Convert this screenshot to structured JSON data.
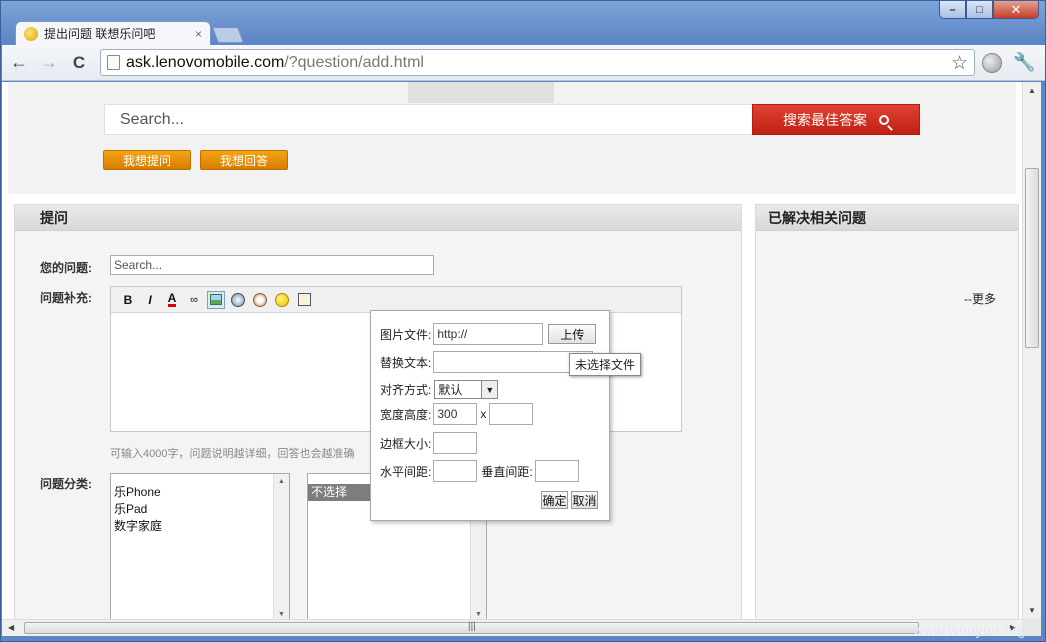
{
  "window": {
    "minimize_icon": "minimize-icon",
    "maximize_icon": "maximize-icon",
    "close_icon": "close-icon"
  },
  "tab": {
    "title": "提出问题 联想乐问吧",
    "close": "×"
  },
  "toolbar": {
    "back": "←",
    "forward": "→",
    "reload": "C",
    "url_host": "ask.lenovomobile.com",
    "url_path": "/?question/add.html",
    "star": "☆",
    "wrench": "🔧"
  },
  "header": {
    "search_placeholder": "Search...",
    "search_button": "搜索最佳答案",
    "ask_button": "我想提问",
    "answer_button": "我想回答"
  },
  "ask_panel": {
    "title": "提问",
    "question_label": "您的问题:",
    "question_placeholder": "Search...",
    "supplement_label": "问题补充:",
    "editor_buttons": {
      "bold": "B",
      "italic": "I",
      "color": "A"
    },
    "hint": "可输入4000字，问题说明越详细，回答也会越准确",
    "category_label": "问题分类:",
    "categories": [
      "乐Phone",
      "乐Pad",
      "数字家庭"
    ],
    "subcategory_selected": "不选择"
  },
  "right_panel": {
    "title": "已解决相关问题",
    "more": "--更多"
  },
  "image_dialog": {
    "file_label": "图片文件:",
    "file_value": "http://",
    "upload_button": "上传",
    "alt_label": "替换文本:",
    "align_label": "对齐方式:",
    "align_value": "默认",
    "size_label": "宽度高度:",
    "width_value": "300",
    "x_sep": "x",
    "border_label": "边框大小:",
    "hspace_label": "水平间距:",
    "vspace_label": "垂直间距:",
    "ok_button": "确定",
    "cancel_button": "取消",
    "tooltip": "未选择文件"
  },
  "watermark": "www.wooyun.org"
}
